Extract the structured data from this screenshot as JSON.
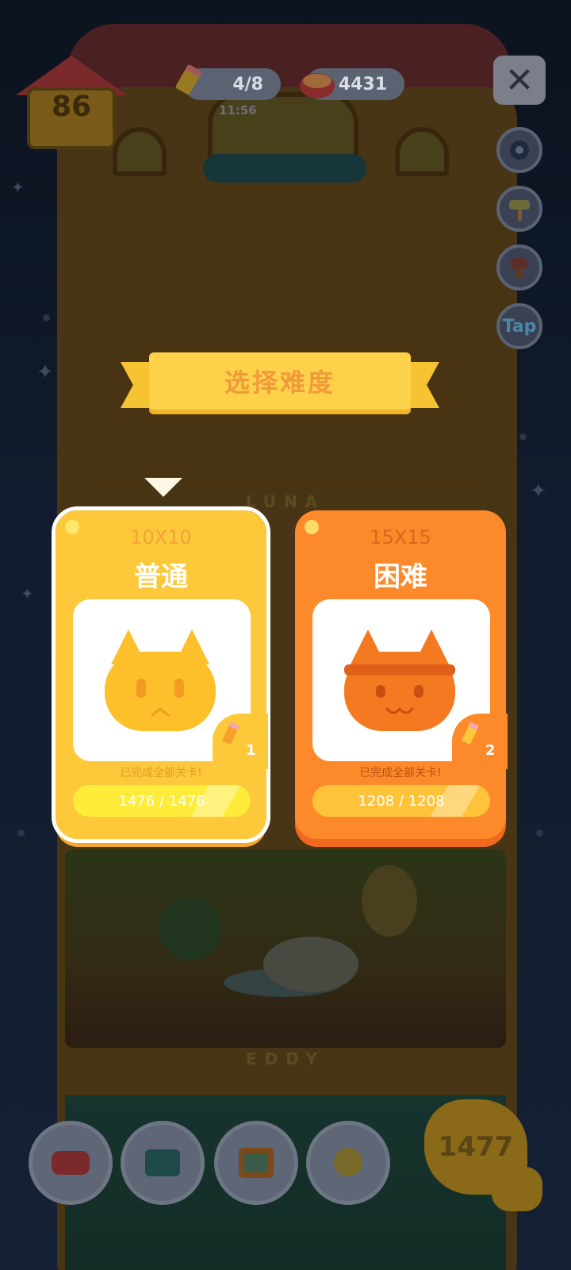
{
  "hud": {
    "house_level": "86",
    "pencil_count": "4/8",
    "timer": "11:56",
    "can_count": "4431",
    "tap_label": "Tap"
  },
  "scene": {
    "floor_label_1": "LUNA",
    "floor_label_2": "EDDY"
  },
  "dialog": {
    "title": "选择难度",
    "cards": [
      {
        "size": "10X10",
        "title": "普通",
        "badge_count": "1",
        "done_text": "已完成全部关卡!",
        "progress_text": "1476 / 1476",
        "progress_completed": 1476,
        "progress_total": 1476,
        "selected": true
      },
      {
        "size": "15X15",
        "title": "困难",
        "badge_count": "2",
        "done_text": "已完成全部关卡!",
        "progress_text": "1208 / 1208",
        "progress_completed": 1208,
        "progress_total": 1208,
        "selected": false
      }
    ]
  },
  "bottom": {
    "total_count": "1477",
    "buttons": [
      "sofa-icon",
      "book-icon",
      "picture-frame-icon",
      "cat-bed-icon"
    ]
  },
  "colors": {
    "normal_card": "#fdc83a",
    "hard_card": "#fd8a2a",
    "ribbon": "#fdd24a",
    "title_text": "#f09a3a"
  }
}
